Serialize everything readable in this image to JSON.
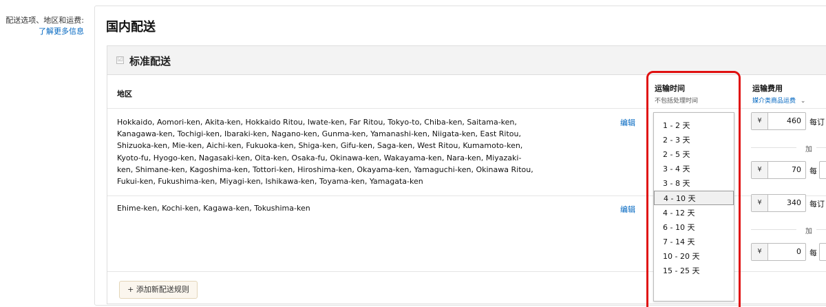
{
  "left": {
    "label": "配送选项、地区和运费:",
    "link": "了解更多信息"
  },
  "panel": {
    "title": "国内配送",
    "section_title": "标准配送",
    "checkbox_glyph": "☑"
  },
  "columns": {
    "region": "地区",
    "transit": "运输时间",
    "transit_sub": "不包括处理时间",
    "fee": "运输费用",
    "fee_sub": "媒介类商品运费",
    "fee_chevron": "⌄"
  },
  "rows": [
    {
      "regions": "Hokkaido, Aomori-ken, Akita-ken, Hokkaido Ritou, Iwate-ken, Far Ritou, Tokyo-to, Chiba-ken, Saitama-ken, Kanagawa-ken, Tochigi-ken, Ibaraki-ken, Nagano-ken, Gunma-ken, Yamanashi-ken, Niigata-ken, East Ritou, Shizuoka-ken, Mie-ken, Aichi-ken, Fukuoka-ken, Shiga-ken, Gifu-ken, Saga-ken, West Ritou, Kumamoto-ken, Kyoto-fu, Hyogo-ken, Nagasaki-ken, Oita-ken, Osaka-fu, Okinawa-ken, Wakayama-ken, Nara-ken, Miyazaki-ken, Shimane-ken, Kagoshima-ken, Tottori-ken, Hiroshima-ken, Okayama-ken, Yamaguchi-ken, Okinawa Ritou, Fukui-ken, Fukushima-ken, Miyagi-ken, Ishikawa-ken, Toyama-ken, Yamagata-ken",
      "edit": "编辑",
      "fee_per_order": "460",
      "per_order_label": "每订",
      "plus_label": "加",
      "fee_per_item": "70",
      "per_item_label": "每"
    },
    {
      "regions": "Ehime-ken, Kochi-ken, Kagawa-ken, Tokushima-ken",
      "edit": "编辑",
      "fee_per_order": "340",
      "per_order_label": "每订",
      "plus_label": "加",
      "fee_per_item": "0",
      "per_item_label": "每"
    }
  ],
  "currency": "¥",
  "add_rule": "+ 添加新配送规则",
  "transit_options": [
    "1 - 2 天",
    "2 - 3 天",
    "2 - 5 天",
    "3 - 4 天",
    "3 - 8 天",
    "4 - 10 天",
    "4 - 12 天",
    "6 - 10 天",
    "7 - 14 天",
    "10 - 20 天",
    "15 - 25 天"
  ],
  "selected_option": "4 - 10 天",
  "colors": {
    "link": "#0066c0",
    "highlight": "#e01010"
  }
}
